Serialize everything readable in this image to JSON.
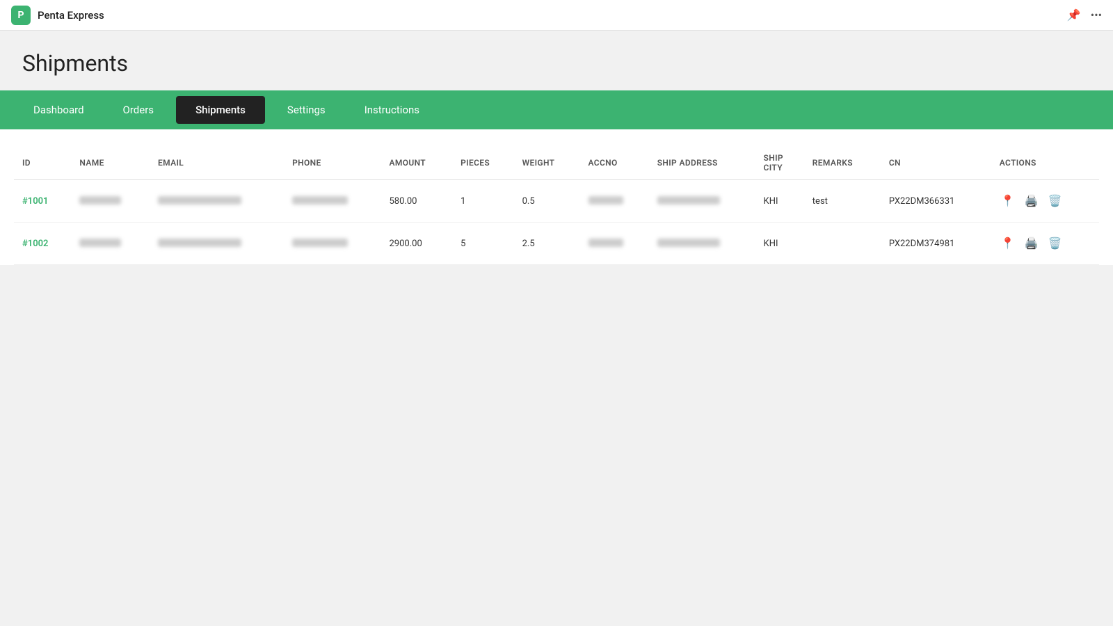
{
  "app": {
    "icon_label": "P",
    "title": "Penta Express",
    "pin_icon": "📌",
    "more_icon": "···"
  },
  "page": {
    "title": "Shipments"
  },
  "nav": {
    "items": [
      {
        "label": "Dashboard",
        "active": false
      },
      {
        "label": "Orders",
        "active": false
      },
      {
        "label": "Shipments",
        "active": true
      },
      {
        "label": "Settings",
        "active": false
      },
      {
        "label": "Instructions",
        "active": false
      }
    ]
  },
  "table": {
    "columns": [
      {
        "key": "id",
        "label": "ID"
      },
      {
        "key": "name",
        "label": "NAME"
      },
      {
        "key": "email",
        "label": "EMAIL"
      },
      {
        "key": "phone",
        "label": "PHONE"
      },
      {
        "key": "amount",
        "label": "AMOUNT"
      },
      {
        "key": "pieces",
        "label": "PIECES"
      },
      {
        "key": "weight",
        "label": "WEIGHT"
      },
      {
        "key": "accno",
        "label": "ACCNO"
      },
      {
        "key": "ship_address",
        "label": "SHIP ADDRESS"
      },
      {
        "key": "ship_city",
        "label": "SHIP CITY"
      },
      {
        "key": "remarks",
        "label": "REMARKS"
      },
      {
        "key": "cn",
        "label": "CN"
      },
      {
        "key": "actions",
        "label": "ACTIONS"
      }
    ],
    "rows": [
      {
        "id": "#1001",
        "name_blurred": true,
        "email_blurred": true,
        "phone_blurred": true,
        "amount": "580.00",
        "pieces": "1",
        "weight": "0.5",
        "accno_blurred": true,
        "ship_address_blurred": true,
        "ship_city": "KHI",
        "remarks": "test",
        "cn": "PX22DM366331"
      },
      {
        "id": "#1002",
        "name_blurred": true,
        "email_blurred": true,
        "phone_blurred": true,
        "amount": "2900.00",
        "pieces": "5",
        "weight": "2.5",
        "accno_blurred": true,
        "ship_address_blurred": true,
        "ship_city": "KHI",
        "remarks": "",
        "cn": "PX22DM374981"
      }
    ]
  }
}
